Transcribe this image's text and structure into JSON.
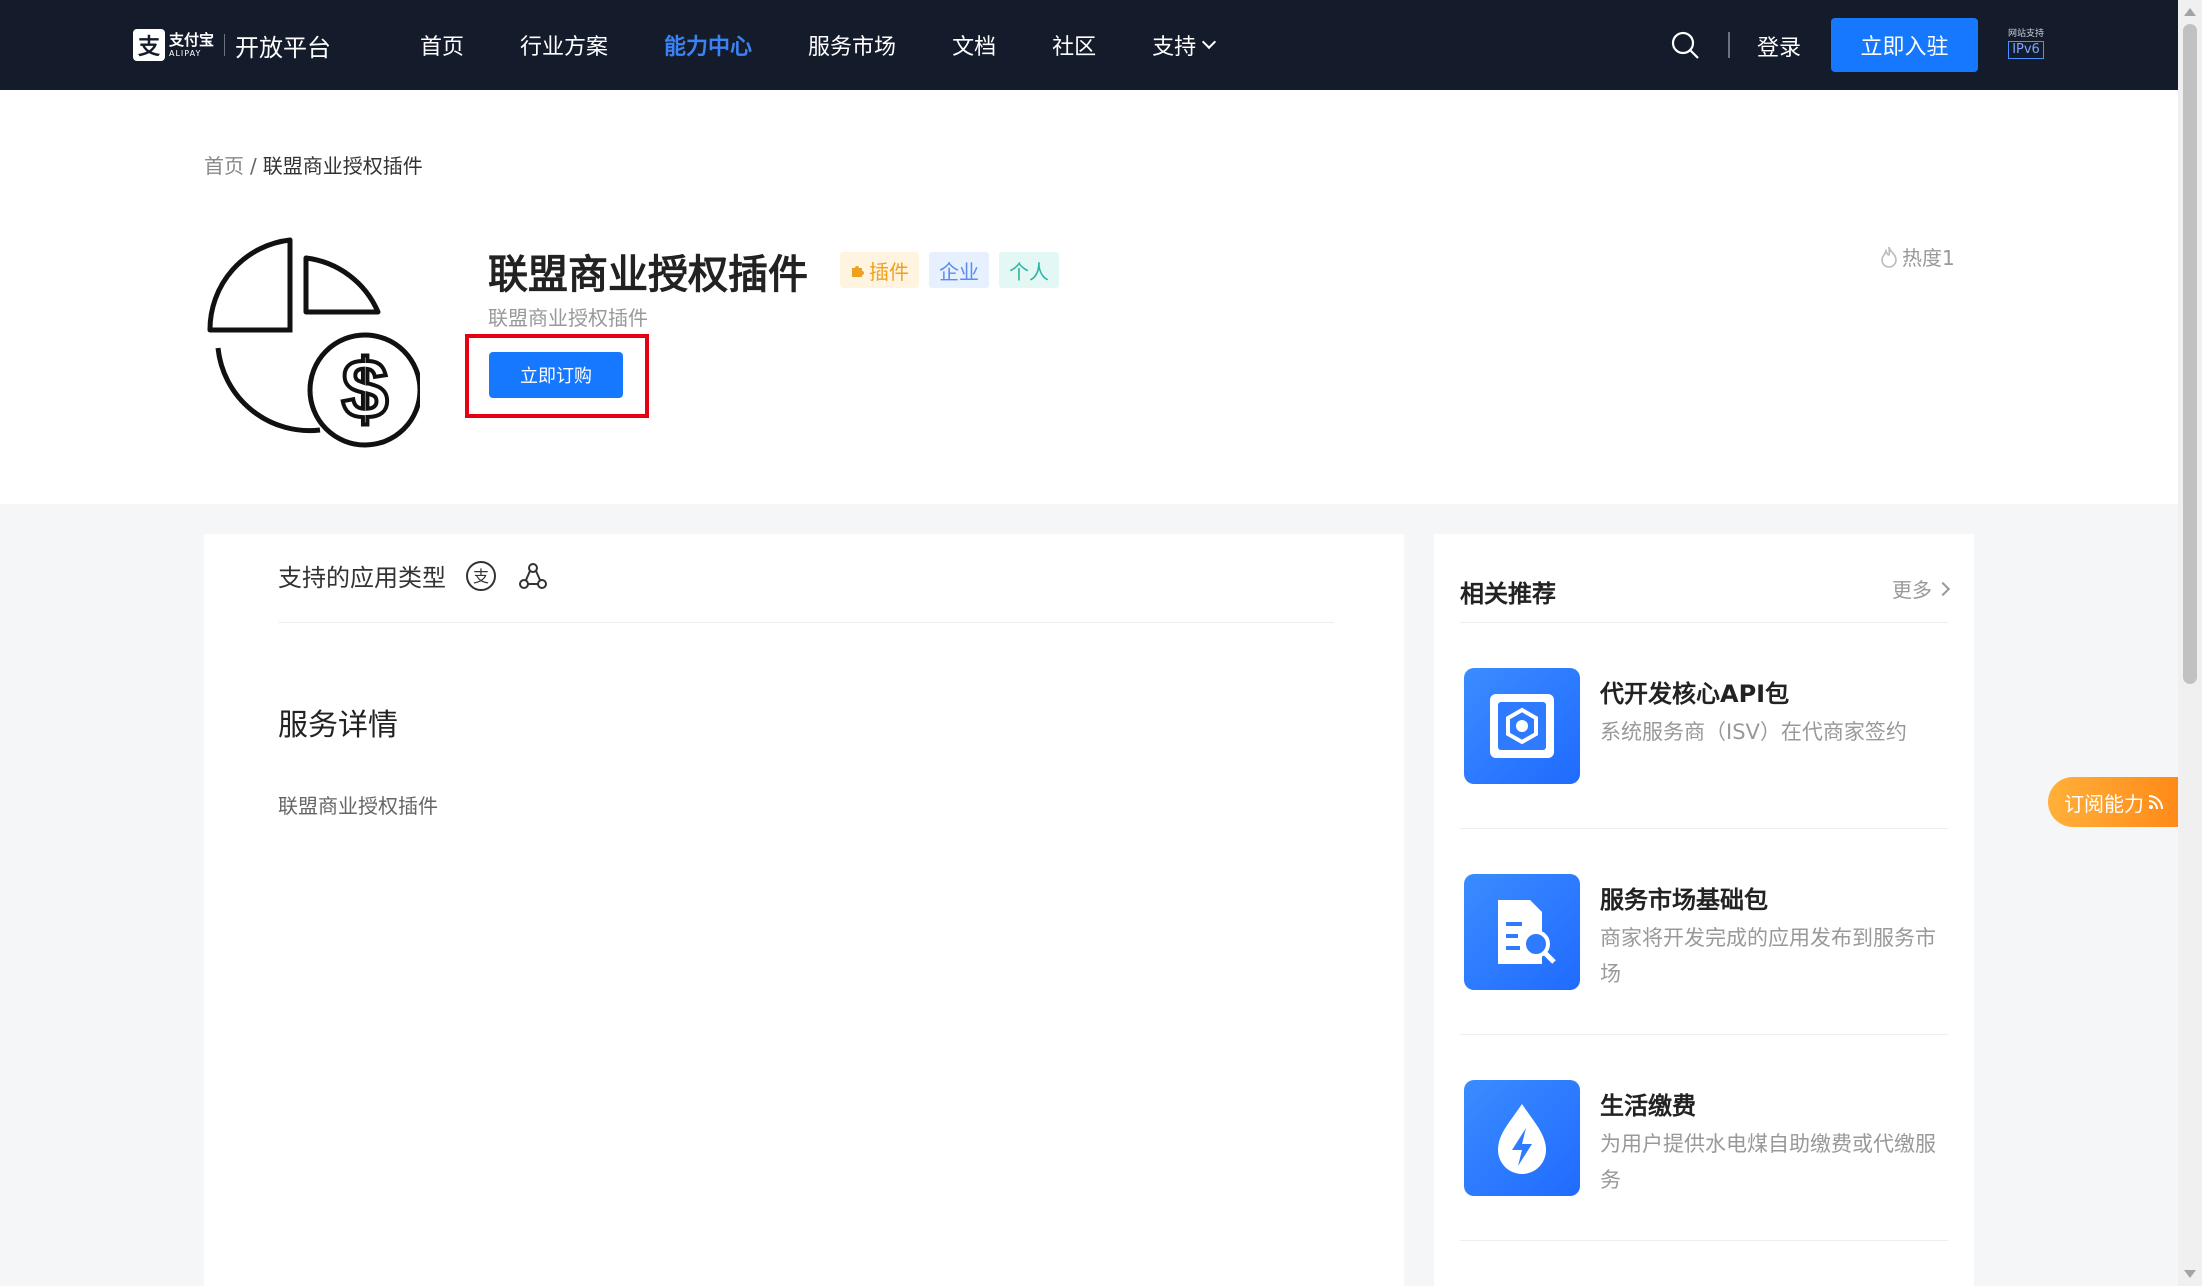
{
  "header": {
    "logo_cn": "支付宝",
    "logo_en": "ALIPAY",
    "platform": "开放平台",
    "nav": [
      "首页",
      "行业方案",
      "能力中心",
      "服务市场",
      "文档",
      "社区",
      "支持"
    ],
    "active_nav": "能力中心",
    "login": "登录",
    "join": "立即入驻",
    "ipv6_small": "网站支持",
    "ipv6": "IPv6"
  },
  "breadcrumb": {
    "home": "首页",
    "separator": "/",
    "current": "联盟商业授权插件"
  },
  "product": {
    "title": "联盟商业授权插件",
    "subtitle": "联盟商业授权插件",
    "tags": [
      "插件",
      "企业",
      "个人"
    ],
    "subscribe": "立即订购",
    "heat": "热度1",
    "icon": "pie-chart-dollar-icon"
  },
  "main": {
    "app_types_label": "支持的应用类型",
    "detail_title": "服务详情",
    "detail_text": "联盟商业授权插件"
  },
  "sidebar": {
    "title": "相关推荐",
    "more": "更多",
    "items": [
      {
        "title": "代开发核心API包",
        "desc": "系统服务商（ISV）在代商家签约",
        "icon": "api-package-icon"
      },
      {
        "title": "服务市场基础包",
        "desc": "商家将开发完成的应用发布到服务市场",
        "icon": "document-search-icon"
      },
      {
        "title": "生活缴费",
        "desc": "为用户提供水电煤自助缴费或代缴服务",
        "icon": "lightning-drop-icon"
      }
    ]
  },
  "float_button": "订阅能力",
  "colors": {
    "header_bg": "#141b2b",
    "primary": "#1677ff",
    "active_nav": "#3b82f6",
    "highlight_box": "#e60012",
    "float_button": "#ff9a25"
  }
}
